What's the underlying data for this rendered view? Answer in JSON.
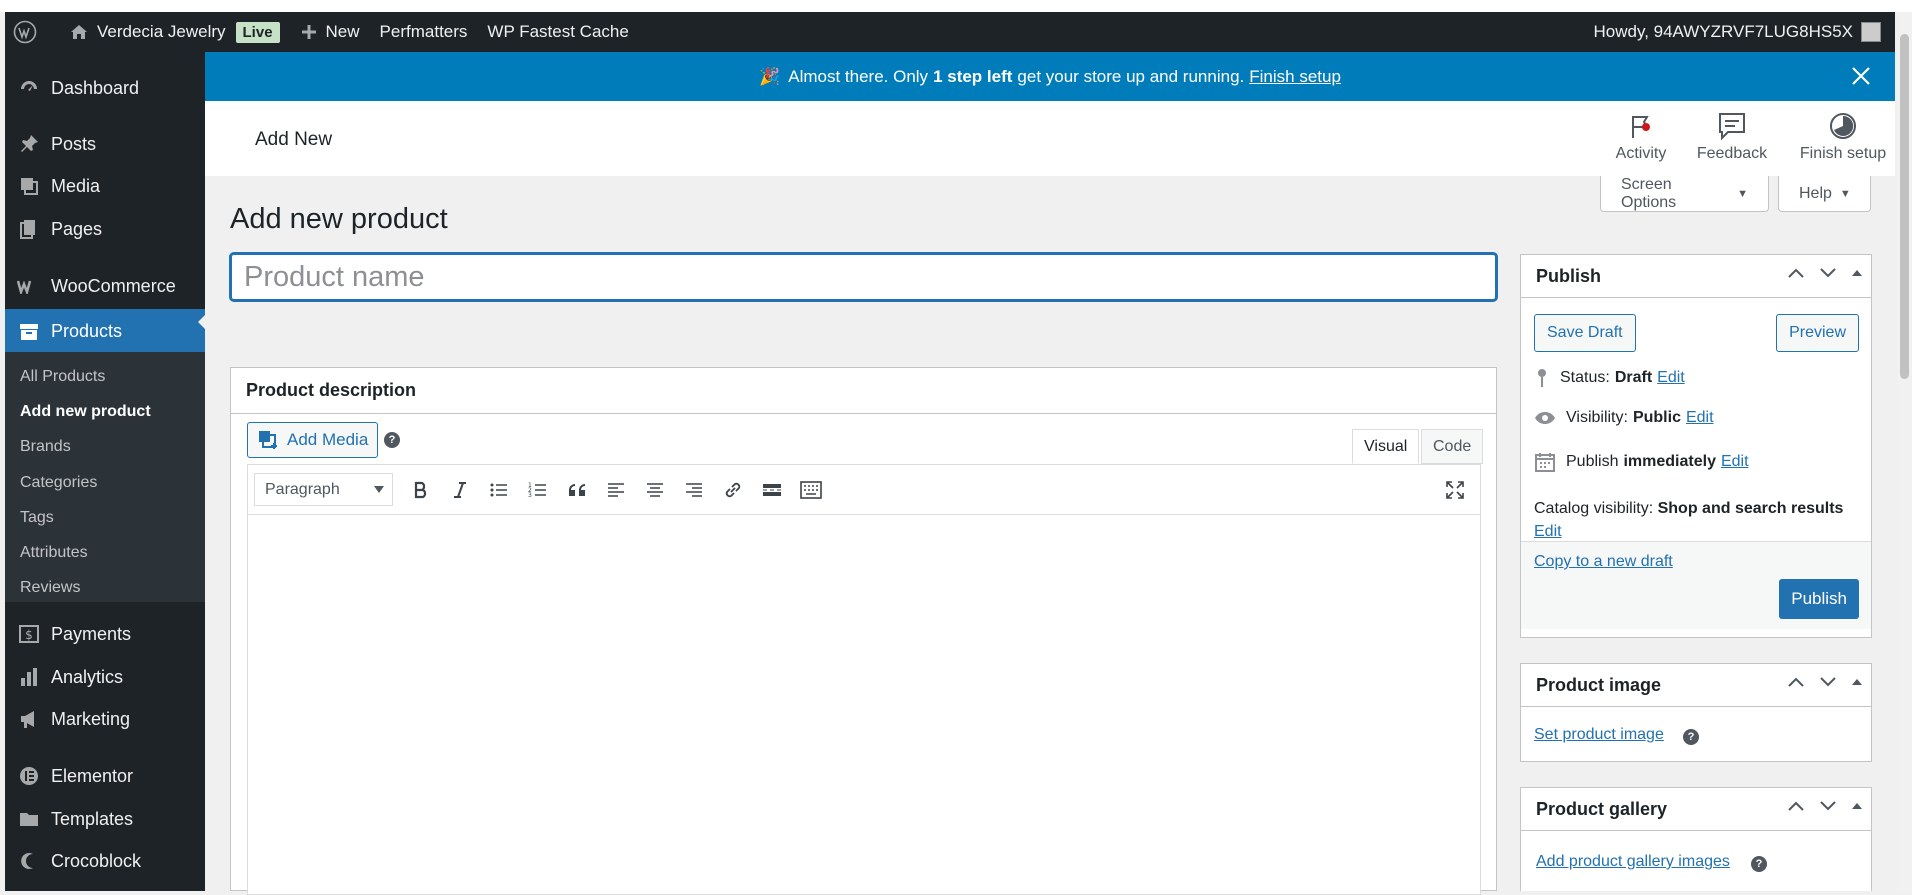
{
  "adminbar": {
    "site_name": "Verdecia Jewelry",
    "live_badge": "Live",
    "new_label": "New",
    "perfmatters": "Perfmatters",
    "cache": "WP Fastest Cache",
    "howdy": "Howdy, 94AWYZRVF7LUG8HS5X"
  },
  "sidebar": {
    "dashboard": "Dashboard",
    "posts": "Posts",
    "media": "Media",
    "pages": "Pages",
    "woocommerce": "WooCommerce",
    "products": "Products",
    "sub": [
      "All Products",
      "Add new product",
      "Brands",
      "Categories",
      "Tags",
      "Attributes",
      "Reviews"
    ],
    "payments": "Payments",
    "analytics": "Analytics",
    "marketing": "Marketing",
    "elementor": "Elementor",
    "templates": "Templates",
    "crocoblock": "Crocoblock"
  },
  "notice": {
    "emoji": "🎉",
    "text_before": "Almost there. Only",
    "bold": "1 step left",
    "text_after": "get your store up and running.",
    "link": "Finish setup"
  },
  "header": {
    "title": "Add New",
    "activity": "Activity",
    "feedback": "Feedback",
    "finish_setup": "Finish setup"
  },
  "screen_options": "Screen Options",
  "help": "Help",
  "main": {
    "page_title": "Add new product",
    "title_placeholder": "Product name",
    "description_title": "Product description",
    "add_media": "Add Media",
    "tab_visual": "Visual",
    "tab_code": "Code",
    "format_select": "Paragraph"
  },
  "publish": {
    "title": "Publish",
    "save_draft": "Save Draft",
    "preview": "Preview",
    "status_label": "Status:",
    "status_value": "Draft",
    "visibility_label": "Visibility:",
    "visibility_value": "Public",
    "publish_label": "Publish",
    "publish_value": "immediately",
    "catalog_label": "Catalog visibility:",
    "catalog_value": "Shop and search results",
    "edit": "Edit",
    "copy_draft": "Copy to a new draft",
    "publish_button": "Publish"
  },
  "product_image": {
    "title": "Product image",
    "link": "Set product image"
  },
  "product_gallery": {
    "title": "Product gallery",
    "link": "Add product gallery images"
  },
  "colors": {
    "admin_dark": "#1d2327",
    "accent": "#2271b1",
    "notice": "#007cba"
  }
}
